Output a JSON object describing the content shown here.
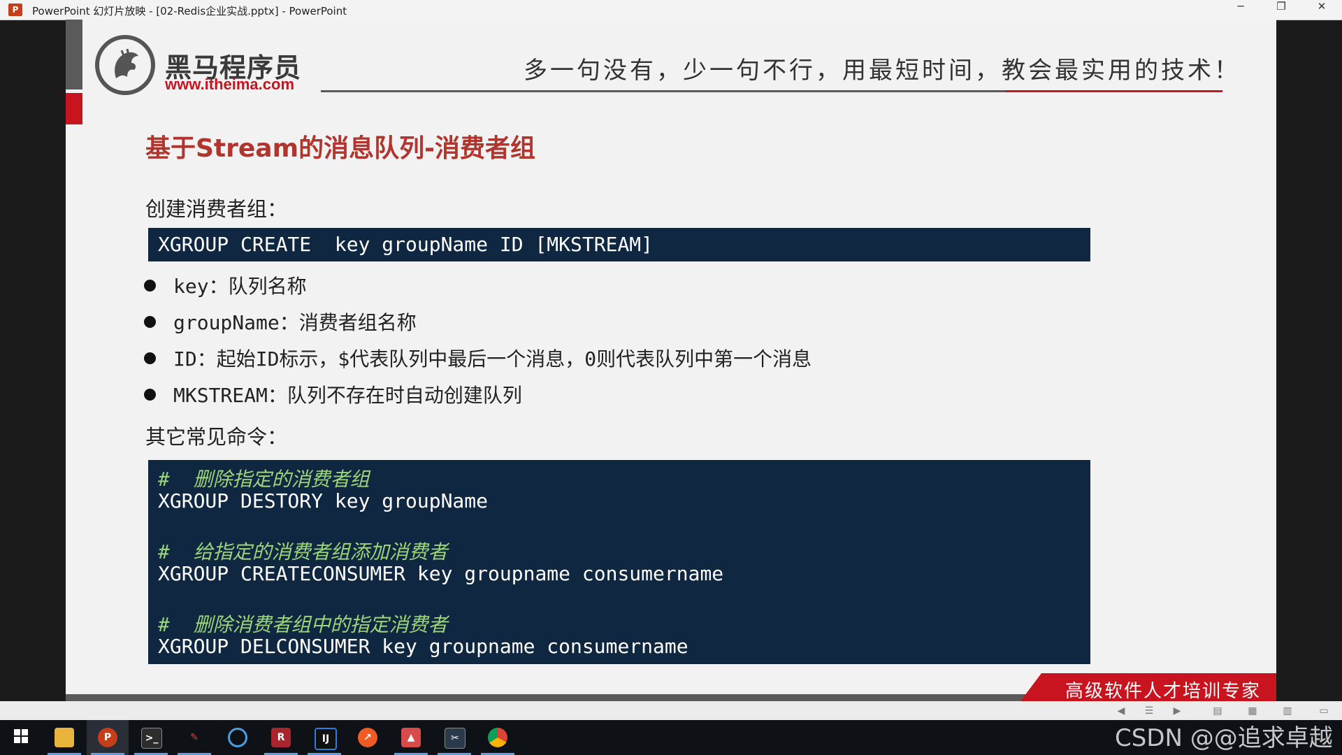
{
  "window": {
    "title": "PowerPoint 幻灯片放映 - [02-Redis企业实战.pptx] - PowerPoint",
    "minimize": "─",
    "restore": "❐",
    "close": "✕"
  },
  "slide": {
    "logo": {
      "name": "黑马程序员",
      "url": "www.itheima.com"
    },
    "slogan": "多一句没有，少一句不行，用最短时间，教会最实用的技术！",
    "title": "基于Stream的消息队列-消费者组",
    "create_label": "创建消费者组：",
    "create_command": "XGROUP CREATE  key groupName ID [MKSTREAM]",
    "bullets": [
      "key：队列名称",
      "groupName：消费者组名称",
      "ID：起始ID标示，$代表队列中最后一个消息，0则代表队列中第一个消息",
      "MKSTREAM：队列不存在时自动创建队列"
    ],
    "other_label": "其它常见命令：",
    "other_code": [
      {
        "comment": "#  删除指定的消费者组",
        "command": "XGROUP DESTORY key groupName"
      },
      {
        "comment": "#  给指定的消费者组添加消费者",
        "command": "XGROUP CREATECONSUMER key groupname consumername"
      },
      {
        "comment": "#  删除消费者组中的指定消费者",
        "command": "XGROUP DELCONSUMER key groupname consumername"
      }
    ],
    "footer_banner": "高级软件人才培训专家"
  },
  "taskbar": {
    "items": [
      "start",
      "file-explorer",
      "powerpoint",
      "terminal",
      "pen-app",
      "browser-app",
      "redis-desktop",
      "intellij",
      "postman",
      "paint-app",
      "screen-tool",
      "chrome"
    ]
  },
  "watermark": "CSDN @@追求卓越",
  "colors": {
    "accent_red": "#c8141e",
    "title_red": "#b0352d",
    "code_bg": "#0f2740",
    "comment_green": "#9bd47a"
  }
}
